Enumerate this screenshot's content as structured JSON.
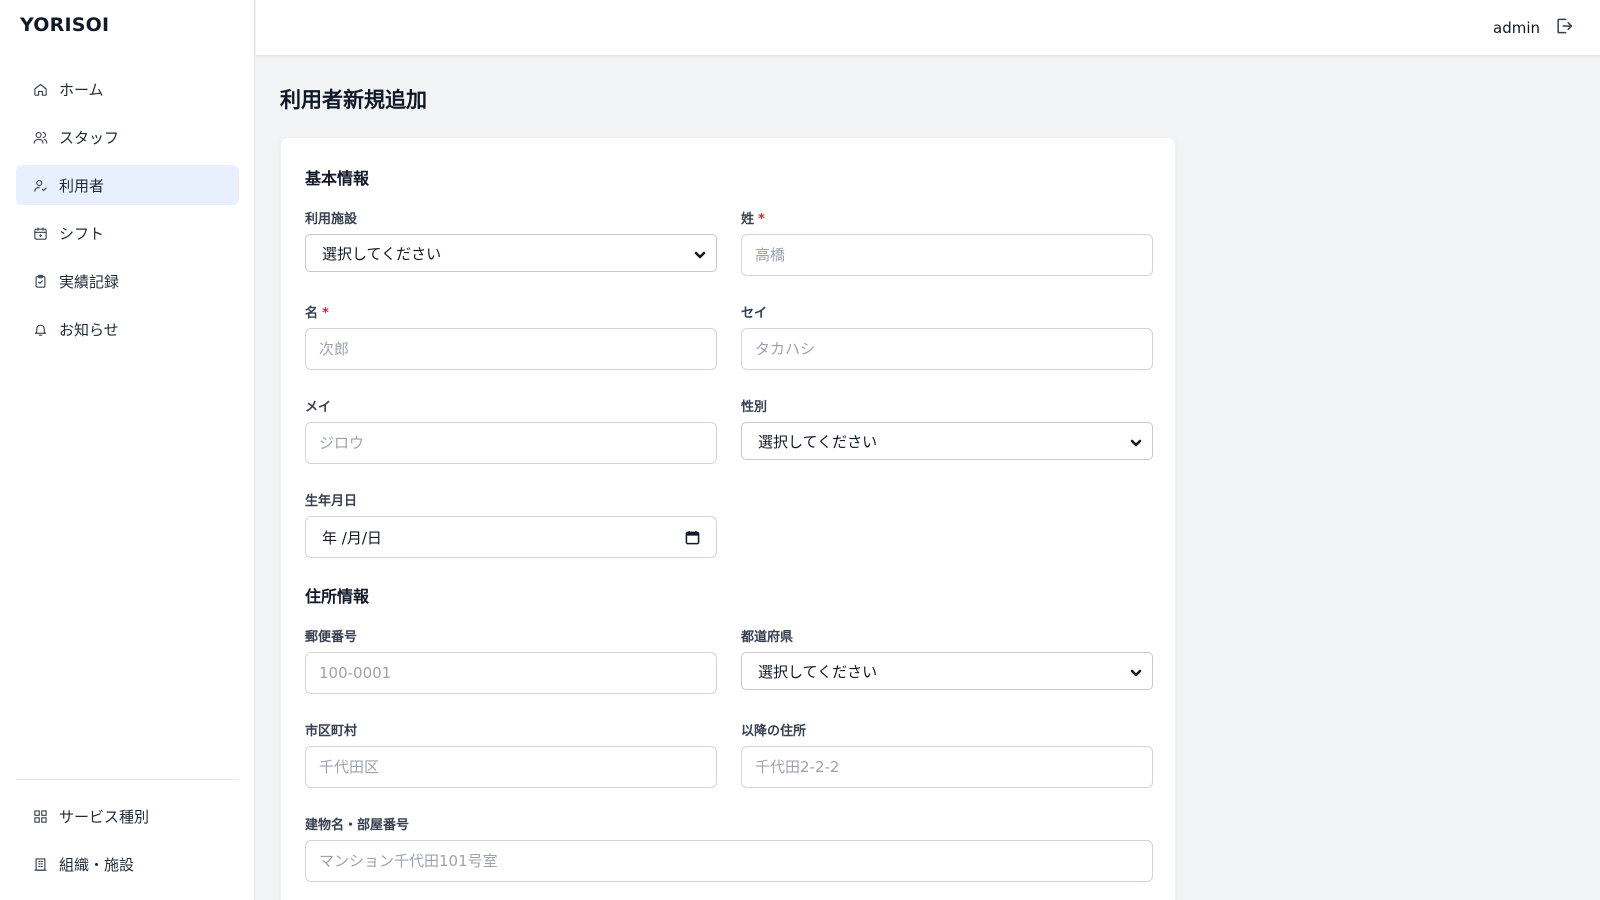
{
  "app": {
    "logo": "YORISOI"
  },
  "sidebar": {
    "items": [
      {
        "label": "ホーム",
        "icon": "home-icon"
      },
      {
        "label": "スタッフ",
        "icon": "users-icon"
      },
      {
        "label": "利用者",
        "icon": "user-icon",
        "active": true
      },
      {
        "label": "シフト",
        "icon": "calendar-icon"
      },
      {
        "label": "実績記録",
        "icon": "clipboard-check-icon"
      },
      {
        "label": "お知らせ",
        "icon": "bell-icon"
      }
    ],
    "bottom_items": [
      {
        "label": "サービス種別",
        "icon": "grid-icon"
      },
      {
        "label": "組織・施設",
        "icon": "building-icon"
      }
    ]
  },
  "header": {
    "user": "admin",
    "logout_icon": "logout-icon"
  },
  "page": {
    "title": "利用者新規追加"
  },
  "basic": {
    "title": "基本情報",
    "facility": {
      "label": "利用施設",
      "value": "選択してください"
    },
    "last_name": {
      "label": "姓",
      "required": "*",
      "placeholder": "高橋"
    },
    "first_name": {
      "label": "名",
      "required": "*",
      "placeholder": "次郎"
    },
    "last_kana": {
      "label": "セイ",
      "placeholder": "タカハシ"
    },
    "first_kana": {
      "label": "メイ",
      "placeholder": "ジロウ"
    },
    "gender": {
      "label": "性別",
      "value": "選択してください"
    },
    "birthdate": {
      "label": "生年月日",
      "value": "年 /月/日"
    }
  },
  "address": {
    "title": "住所情報",
    "postal": {
      "label": "郵便番号",
      "placeholder": "100-0001"
    },
    "prefecture": {
      "label": "都道府県",
      "value": "選択してください"
    },
    "city": {
      "label": "市区町村",
      "placeholder": "千代田区"
    },
    "street": {
      "label": "以降の住所",
      "placeholder": "千代田2-2-2"
    },
    "building": {
      "label": "建物名・部屋番号",
      "placeholder": "マンション千代田101号室"
    }
  },
  "colors": {
    "active_nav_bg": "#e8f0fe",
    "required": "#dc2626",
    "page_bg": "#f3f4f6"
  }
}
